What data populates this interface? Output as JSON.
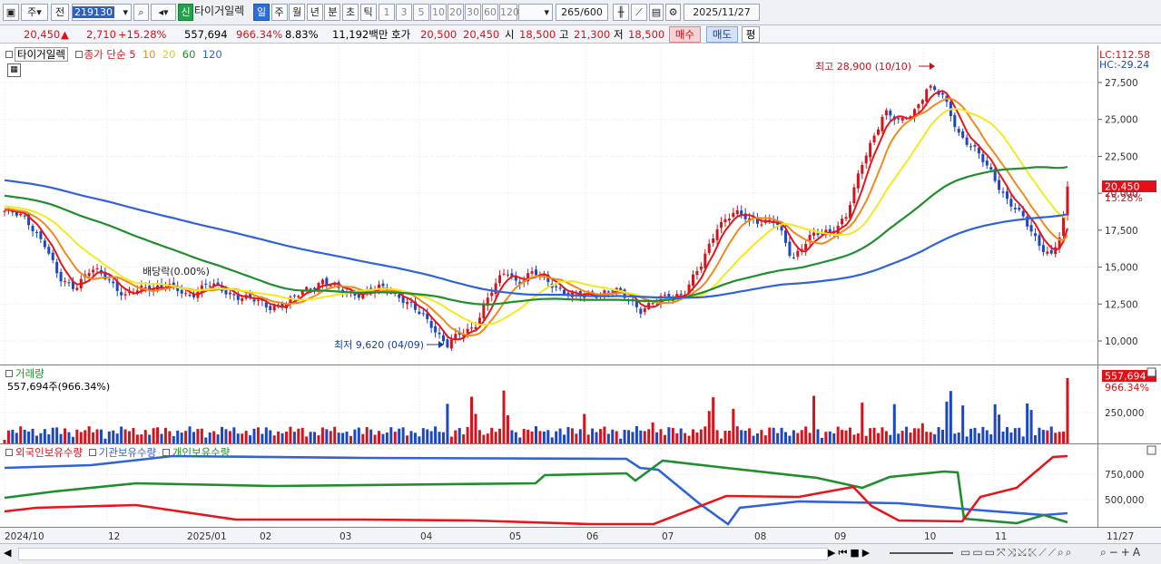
{
  "toolbar": {
    "period_day": "주",
    "prev": "전",
    "code": "219130",
    "sin_badge": "신",
    "stock_name": "타이거일렉",
    "tabs": [
      "일",
      "주",
      "월",
      "년",
      "분",
      "초",
      "틱"
    ],
    "active_tab": "일",
    "intervals": [
      "1",
      "3",
      "5",
      "10",
      "20",
      "30",
      "60",
      "120"
    ],
    "count": "265",
    "count_total": "/600",
    "date": "2025/11/27"
  },
  "quote": {
    "price": "20,450",
    "change": "2,710",
    "change_pct": "+15.28%",
    "volume": "557,694",
    "vol_ratio": "966.34%",
    "turnover": "8.83%",
    "amount": "11,192백만",
    "hoga_label": "호가",
    "ask": "20,500",
    "bid": "20,450",
    "open_label": "시",
    "open": "18,500",
    "high_label": "고",
    "high": "21,300",
    "low_label": "저",
    "low": "18,500",
    "buy": "매수",
    "sell": "매도",
    "avg": "평"
  },
  "legend": {
    "name": "타이거일렉",
    "ma_label": "종가 단순",
    "ma5": "5",
    "ma10": "10",
    "ma20": "20",
    "ma60": "60",
    "ma120": "120",
    "lc": "LC:112.58",
    "hc": "HC:-29.24",
    "dividend": "배당락(0.00%)",
    "max_note": "최고 28,900 (10/10)",
    "min_note": "최저 9,620 (04/09)",
    "last_price": "20,450",
    "last_pct": "15.28%"
  },
  "volume_panel": {
    "title": "거래량",
    "value": "557,694주(966.34%)",
    "last": "557,694",
    "last_pct": "966.34%"
  },
  "holder_panel": {
    "foreign": "외국인보유수량",
    "inst": "기관보유수량",
    "indiv": "개인보유수량"
  },
  "price_axis": [
    "27,500",
    "25,000",
    "22,500",
    "20,000",
    "17,500",
    "15,000",
    "12,500",
    "10,000"
  ],
  "vol_axis": [
    "250,000"
  ],
  "holder_axis": [
    "750,000",
    "500,000"
  ],
  "x_axis": [
    "2024/10",
    "12",
    "2025/01",
    "02",
    "03",
    "04",
    "05",
    "06",
    "07",
    "08",
    "09",
    "10",
    "11",
    "11/27"
  ],
  "colors": {
    "up": "#d4141c",
    "down": "#1b46c4",
    "ma5": "#e8151b",
    "ma10": "#f08a1c",
    "ma20": "#f2ea1c",
    "ma60": "#1f8e2c",
    "ma120": "#2f62db"
  }
}
